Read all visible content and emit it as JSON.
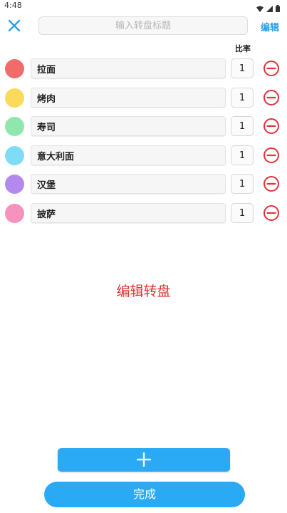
{
  "status_bar": {
    "time": "4:48"
  },
  "header": {
    "title_placeholder": "输入转盘标题",
    "title_value": "",
    "edit_label": "编辑"
  },
  "ratio_header": "比率",
  "items": [
    {
      "label": "拉面",
      "ratio": "1",
      "color": "#f26b6b"
    },
    {
      "label": "烤肉",
      "ratio": "1",
      "color": "#fbd95a"
    },
    {
      "label": "寿司",
      "ratio": "1",
      "color": "#8ee8ad"
    },
    {
      "label": "意大利面",
      "ratio": "1",
      "color": "#7fdcf7"
    },
    {
      "label": "汉堡",
      "ratio": "1",
      "color": "#b489ee"
    },
    {
      "label": "披萨",
      "ratio": "1",
      "color": "#f592bd"
    }
  ],
  "center_title": "编辑转盘",
  "done_label": "完成",
  "colors": {
    "accent": "#2aa9f5",
    "remove": "#e0333b",
    "title_red": "#e0332b"
  }
}
